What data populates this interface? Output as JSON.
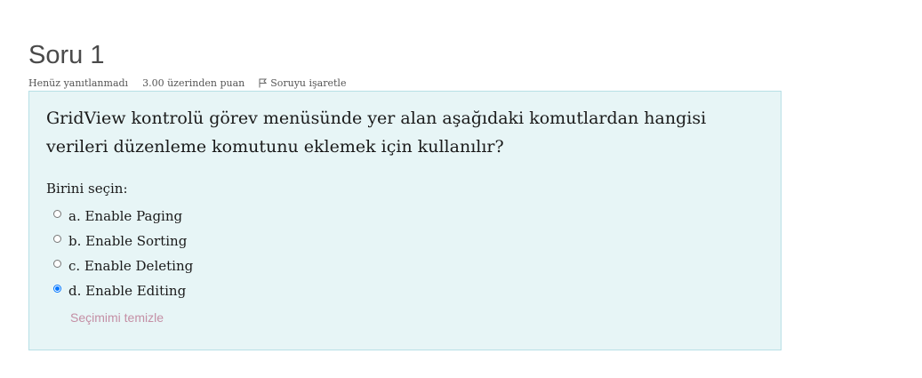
{
  "question": {
    "title": "Soru 1",
    "state": "Henüz yanıtlanmadı",
    "grade": "3.00 üzerinden puan",
    "flag_label": "Soruyu işaretle",
    "text": "GridView kontrolü görev menüsünde yer alan aşağıdaki komutlardan hangisi verileri düzenleme komutunu eklemek için kullanılır?",
    "prompt": "Birini seçin:",
    "answers": [
      {
        "label": "a. Enable Paging",
        "selected": false
      },
      {
        "label": "b. Enable Sorting",
        "selected": false
      },
      {
        "label": "c. Enable Deleting",
        "selected": false
      },
      {
        "label": "d. Enable Editing",
        "selected": true
      }
    ],
    "clear_label": "Seçimimi temizle"
  },
  "colors": {
    "box_background": "#e7f5f6",
    "box_border": "#b8e0e6",
    "radio_selected": "#0075ff",
    "clear_link": "#c48fa5"
  }
}
